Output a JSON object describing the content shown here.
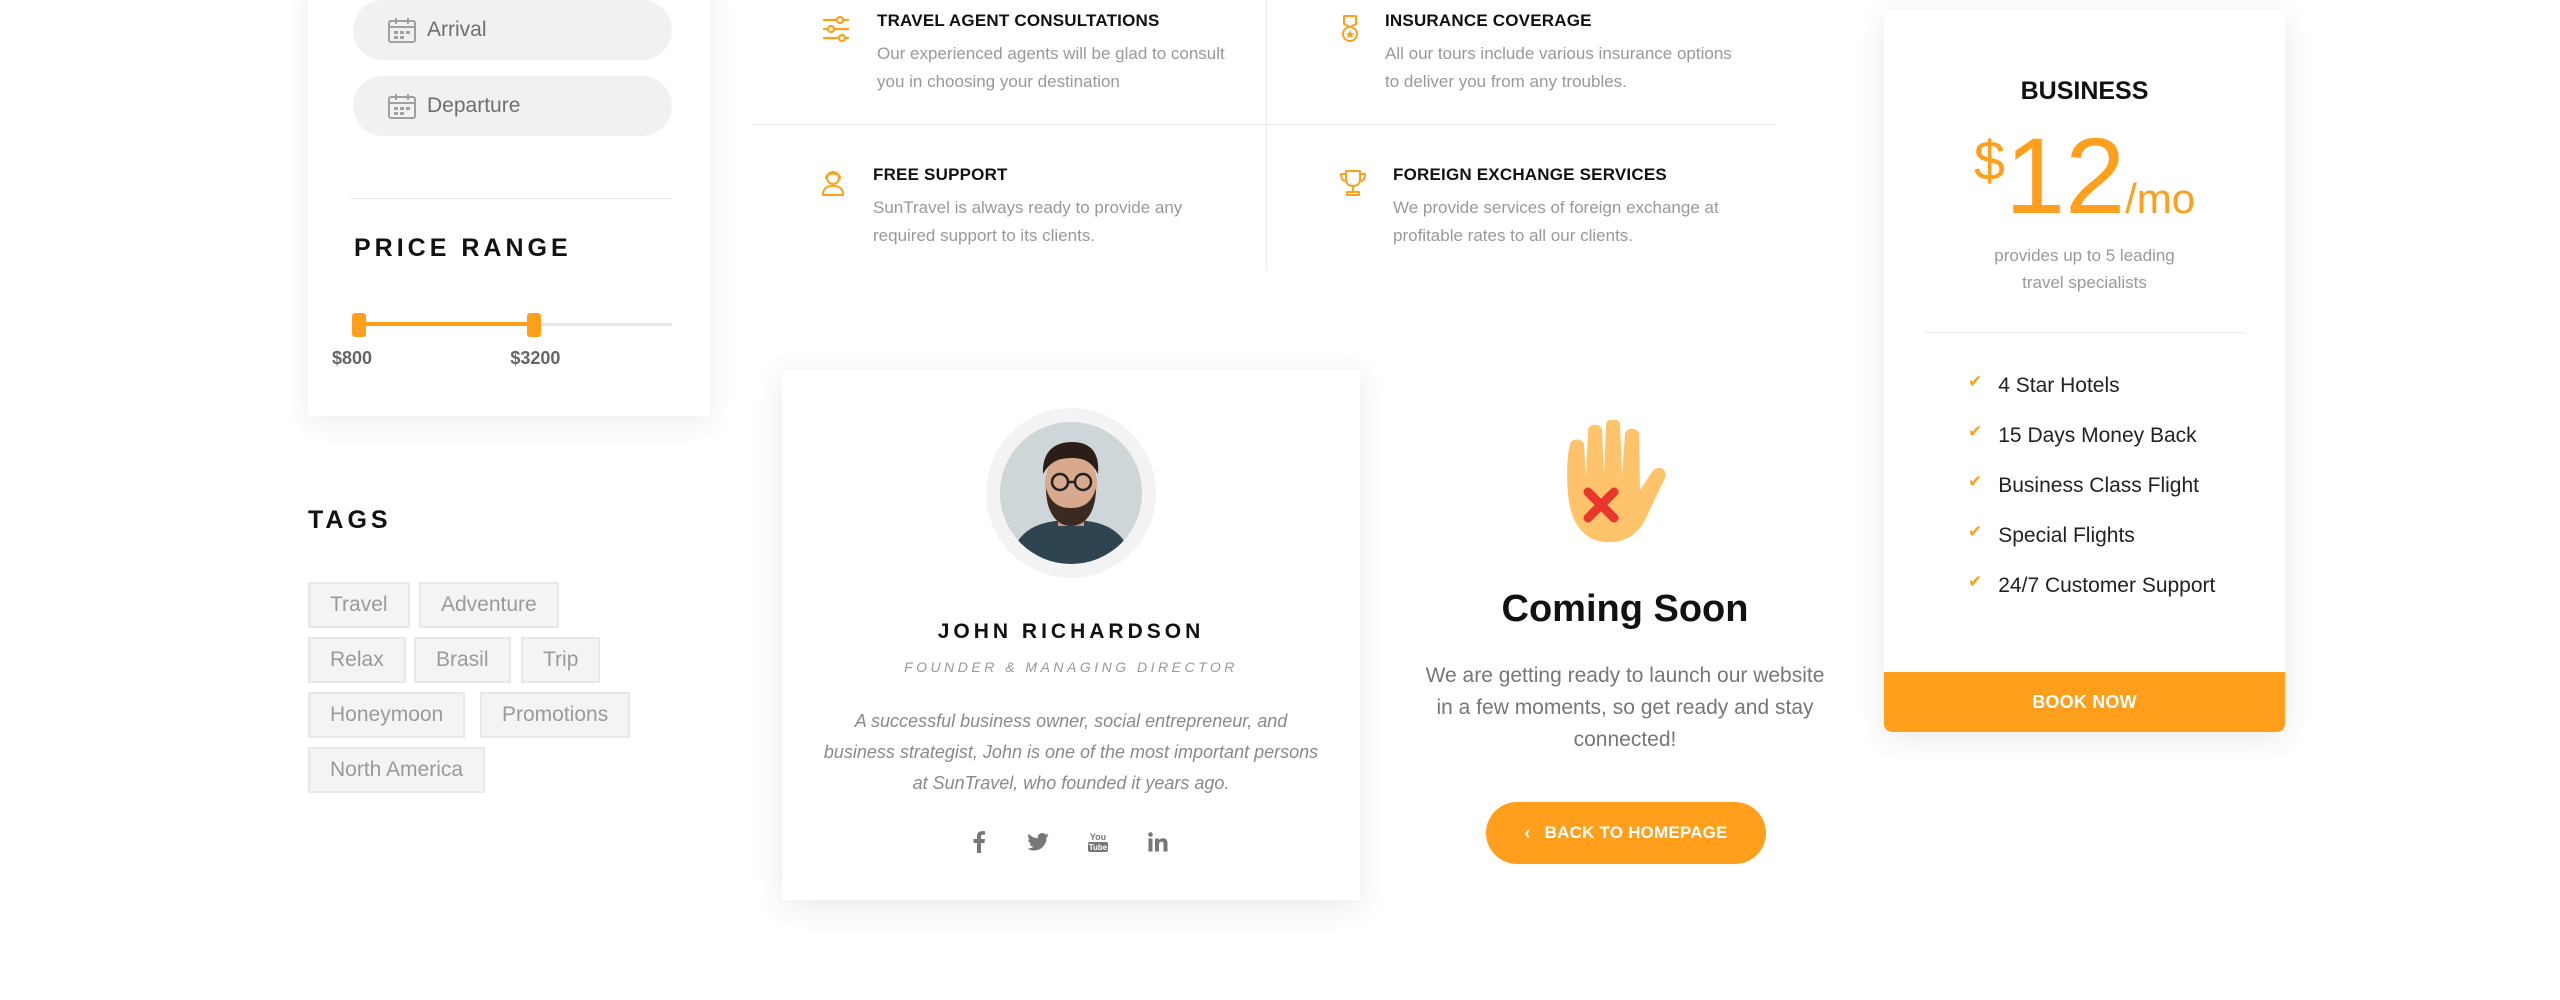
{
  "search": {
    "arrival_placeholder": "Arrival",
    "departure_placeholder": "Departure"
  },
  "price_range": {
    "title": "PRICE RANGE",
    "min_label": "$800",
    "max_label": "$3200",
    "min_fraction": 0.0,
    "max_fraction": 0.57
  },
  "tags": {
    "title": "TAGS",
    "items": [
      "Travel",
      "Adventure",
      "Relax",
      "Brasil",
      "Trip",
      "Honeymoon",
      "Promotions",
      "North America"
    ]
  },
  "features": [
    {
      "icon": "sliders-icon",
      "title": "TRAVEL AGENT CONSULTATIONS",
      "text": "Our experienced agents will be glad to consult you in choosing your destination"
    },
    {
      "icon": "medal-icon",
      "title": "INSURANCE COVERAGE",
      "text": "All our tours include various insurance options to deliver you from any troubles."
    },
    {
      "icon": "support-icon",
      "title": "FREE SUPPORT",
      "text": "SunTravel is always ready to provide any required support to its clients."
    },
    {
      "icon": "trophy-icon",
      "title": "FOREIGN EXCHANGE SERVICES",
      "text": "We provide services of foreign exchange at profitable rates to all our clients."
    }
  ],
  "profile": {
    "name": "JOHN RICHARDSON",
    "role": "FOUNDER & MANAGING DIRECTOR",
    "bio": "A successful business owner, social entrepreneur, and business strategist, John is one of the most important persons at SunTravel, who founded it years ago.",
    "socials": [
      "facebook-icon",
      "twitter-icon",
      "youtube-icon",
      "linkedin-icon"
    ]
  },
  "coming_soon": {
    "title": "Coming Soon",
    "text": "We are getting ready to launch our website in a few moments, so get ready and stay connected!",
    "button": "BACK TO HOMEPAGE"
  },
  "pricing": {
    "plan": "BUSINESS",
    "currency": "$",
    "amount": "12",
    "period": "/mo",
    "description": "provides up to 5 leading travel specialists",
    "features": [
      "4 Star Hotels",
      "15 Days Money Back",
      "Business Class Flight",
      "Special Flights",
      "24/7 Customer Support"
    ],
    "button": "BOOK NOW"
  },
  "colors": {
    "accent": "#ff9f1c",
    "hand": "#ffc46b",
    "cross": "#e8362d"
  }
}
